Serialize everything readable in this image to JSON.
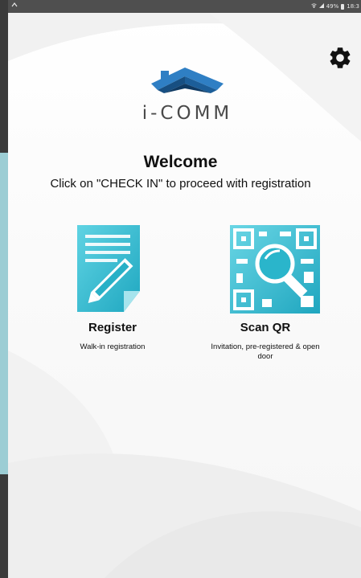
{
  "status_bar": {
    "right_text": "49%",
    "time": "18:3"
  },
  "logo": {
    "text": "i-COMM",
    "roof_color": "#2f7fc4"
  },
  "welcome": {
    "title": "Welcome",
    "subtitle": "Click on \"CHECK IN\" to proceed with registration"
  },
  "options": {
    "register": {
      "icon": "register-document-pencil-icon",
      "title": "Register",
      "description": "Walk-in registration"
    },
    "scan_qr": {
      "icon": "qr-magnifier-icon",
      "title": "Scan QR",
      "description": "Invitation, pre-registered & open door"
    }
  },
  "settings": {
    "icon": "gear-icon"
  },
  "colors": {
    "accent_teal": "#2bb9cf",
    "logo_blue": "#2f7fc4",
    "status_bar": "#4f4f4f"
  }
}
